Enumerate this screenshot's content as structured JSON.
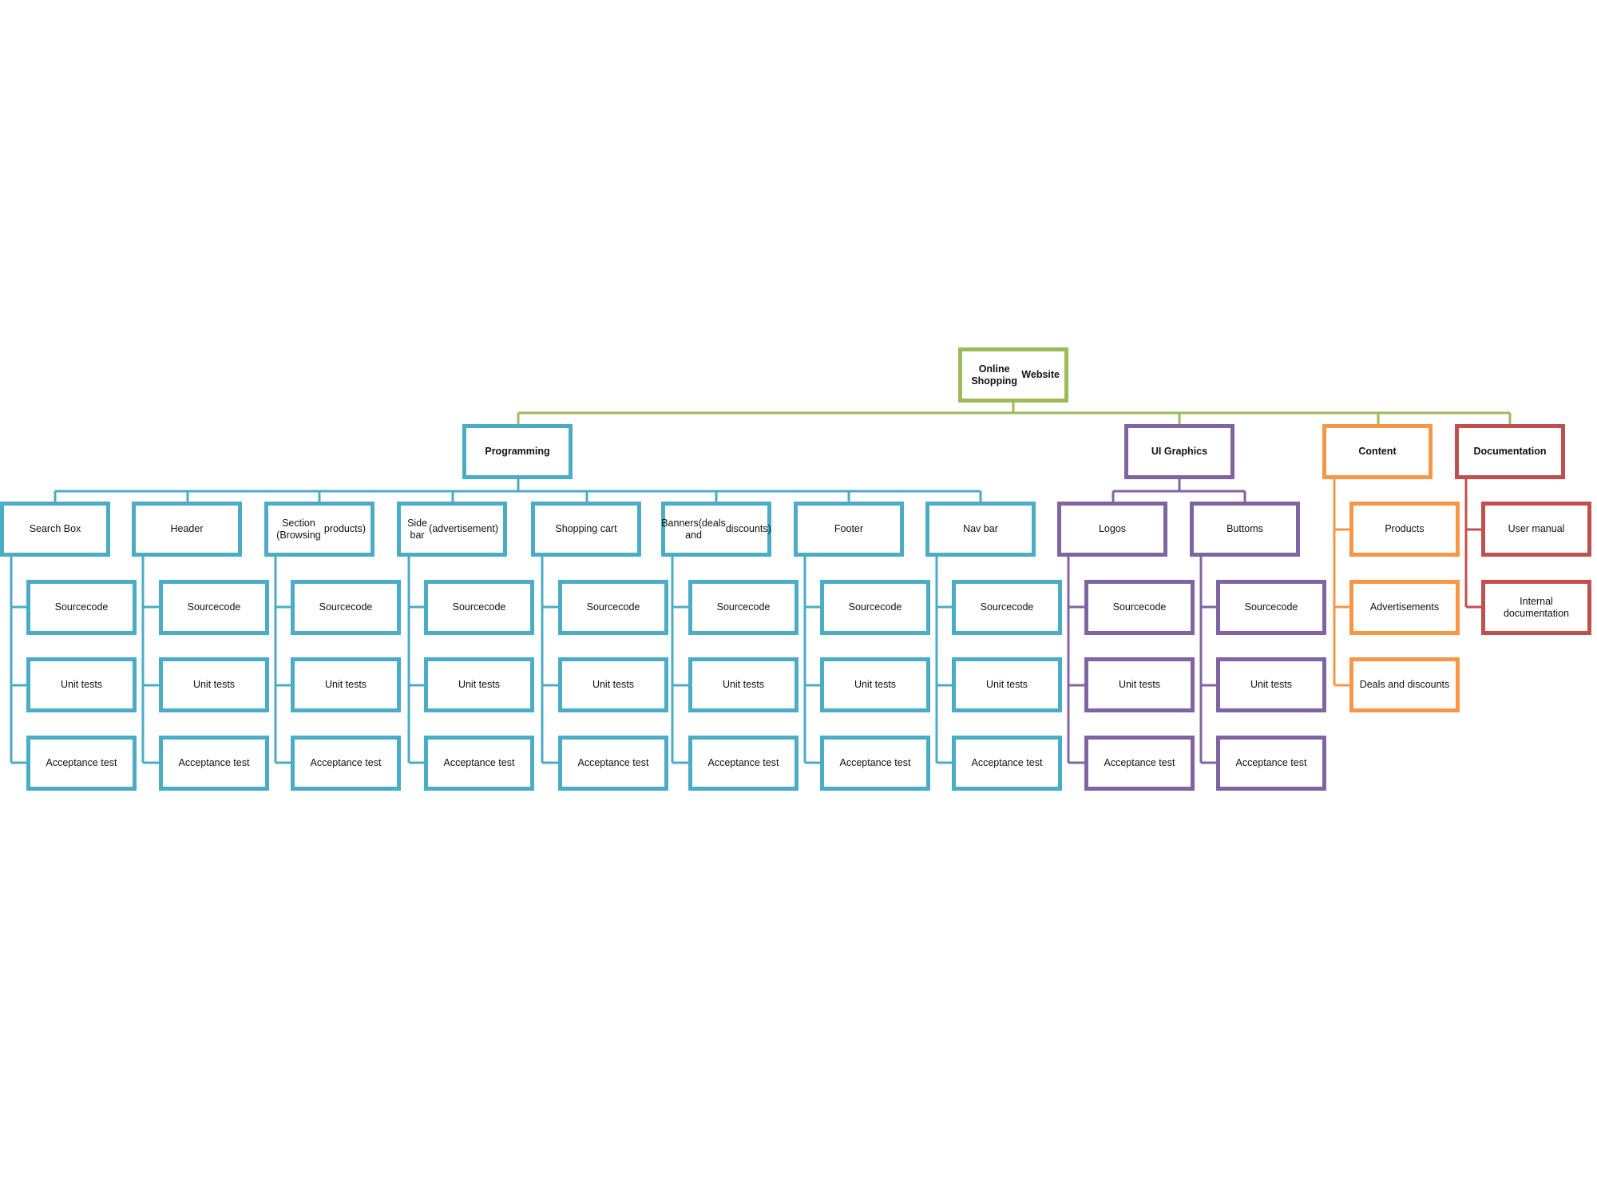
{
  "colors": {
    "root": "#9bbb59",
    "programming": "#4bacc6",
    "ui_graphics": "#8064a2",
    "content": "#f79646",
    "documentation": "#c0504d"
  },
  "root": {
    "label": "Online Shopping\nWebsite"
  },
  "branches": [
    {
      "id": "programming",
      "label": "Programming",
      "color_key": "programming",
      "children": [
        {
          "label": "Search Box",
          "items": [
            "Sourcecode",
            "Unit tests",
            "Acceptance test"
          ]
        },
        {
          "label": "Header",
          "items": [
            "Sourcecode",
            "Unit tests",
            "Acceptance test"
          ]
        },
        {
          "label": "Section (Browsing\nproducts)",
          "items": [
            "Sourcecode",
            "Unit tests",
            "Acceptance test"
          ]
        },
        {
          "label": "Side bar\n(advertisement)",
          "items": [
            "Sourcecode",
            "Unit tests",
            "Acceptance test"
          ]
        },
        {
          "label": "Shopping cart",
          "items": [
            "Sourcecode",
            "Unit tests",
            "Acceptance test"
          ]
        },
        {
          "label": "Banners(deals and\ndiscounts)",
          "items": [
            "Sourcecode",
            "Unit tests",
            "Acceptance test"
          ]
        },
        {
          "label": "Footer",
          "items": [
            "Sourcecode",
            "Unit tests",
            "Acceptance test"
          ]
        },
        {
          "label": "Nav bar",
          "items": [
            "Sourcecode",
            "Unit tests",
            "Acceptance test"
          ]
        }
      ]
    },
    {
      "id": "ui-graphics",
      "label": "UI Graphics",
      "color_key": "ui_graphics",
      "children": [
        {
          "label": "Logos",
          "items": [
            "Sourcecode",
            "Unit tests",
            "Acceptance test"
          ]
        },
        {
          "label": "Buttoms",
          "items": [
            "Sourcecode",
            "Unit tests",
            "Acceptance test"
          ]
        }
      ]
    },
    {
      "id": "content",
      "label": "Content",
      "color_key": "content",
      "items": [
        "Products",
        "Advertisements",
        "Deals and discounts"
      ]
    },
    {
      "id": "documentation",
      "label": "Documentation",
      "color_key": "documentation",
      "items": [
        "User manual",
        "Internal documentation"
      ]
    }
  ]
}
